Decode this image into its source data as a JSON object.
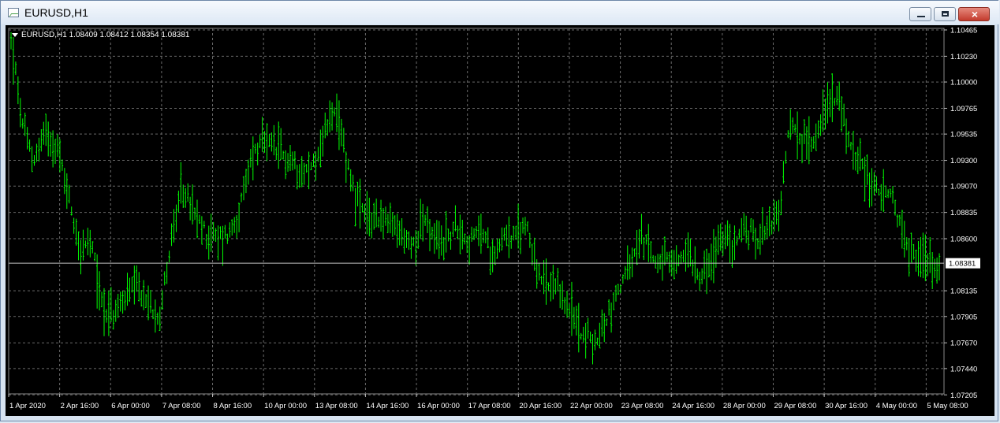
{
  "window": {
    "title": "EURUSD,H1",
    "icon": "chart-window-icon",
    "close_label": "×"
  },
  "chart_header": {
    "symbol_line": "EURUSD,H1  1.08409 1.08412 1.08354 1.08381"
  },
  "colors": {
    "background": "#000000",
    "grid": "#6b6b6b",
    "candle": "#00ff00",
    "axis_text": "#ffffff",
    "current_price_label_bg": "#ffffff"
  },
  "chart_data": {
    "type": "bar",
    "timeframe": "H1",
    "symbol": "EURUSD",
    "ylim": [
      1.072,
      1.10465
    ],
    "current_price": 1.08381,
    "y_ticks": [
      1.10465,
      1.1023,
      1.1,
      1.09765,
      1.09535,
      1.093,
      1.0907,
      1.08835,
      1.086,
      1.08381,
      1.08135,
      1.07905,
      1.0767,
      1.0744,
      1.07205
    ],
    "x_tick_labels": [
      "1 Apr 2020",
      "2 Apr 16:00",
      "6 Apr 00:00",
      "7 Apr 08:00",
      "8 Apr 16:00",
      "10 Apr 00:00",
      "13 Apr 08:00",
      "14 Apr 16:00",
      "16 Apr 00:00",
      "17 Apr 08:00",
      "20 Apr 16:00",
      "22 Apr 00:00",
      "23 Apr 08:00",
      "24 Apr 16:00",
      "28 Apr 00:00",
      "29 Apr 08:00",
      "30 Apr 16:00",
      "4 May 00:00",
      "5 May 08:00"
    ],
    "price_path": [
      1.104,
      1.096,
      1.093,
      1.0958,
      1.0942,
      1.09,
      1.085,
      1.0855,
      1.08,
      1.079,
      1.081,
      1.0815,
      1.08,
      1.0795,
      1.086,
      1.0905,
      1.088,
      1.0865,
      1.086,
      1.0865,
      1.0885,
      1.0935,
      1.0945,
      1.094,
      1.0932,
      1.0925,
      1.092,
      1.094,
      1.0975,
      1.0945,
      1.09,
      1.0875,
      1.0882,
      1.0872,
      1.0865,
      1.0852,
      1.088,
      1.0855,
      1.086,
      1.0872,
      1.0855,
      1.0868,
      1.0845,
      1.0865,
      1.086,
      1.0875,
      1.0825,
      1.0815,
      1.0812,
      1.079,
      1.0775,
      1.0765,
      1.079,
      1.0815,
      1.0835,
      1.086,
      1.0845,
      1.084,
      1.0835,
      1.085,
      1.083,
      1.0835,
      1.086,
      1.0855,
      1.087,
      1.086,
      1.0875,
      1.088,
      1.0965,
      1.0945,
      1.095,
      1.0975,
      1.099,
      1.095,
      1.093,
      1.091,
      1.09,
      1.0895,
      1.0855,
      1.0845,
      1.084,
      1.0838
    ],
    "bar_count": 400
  }
}
